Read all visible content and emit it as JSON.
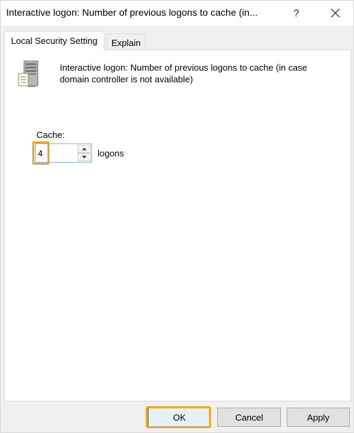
{
  "window": {
    "title": "Interactive logon: Number of previous logons to cache (in...",
    "help_glyph": "?"
  },
  "tabs": [
    {
      "label": "Local Security Setting"
    },
    {
      "label": "Explain"
    }
  ],
  "setting": {
    "description": "Interactive logon: Number of previous logons to cache (in case domain controller is not available)",
    "field_label": "Cache:",
    "value": "4",
    "unit": "logons"
  },
  "buttons": {
    "ok": "OK",
    "cancel": "Cancel",
    "apply": "Apply"
  },
  "colors": {
    "highlight": "#e9a825",
    "focus_border": "#0078d7"
  }
}
